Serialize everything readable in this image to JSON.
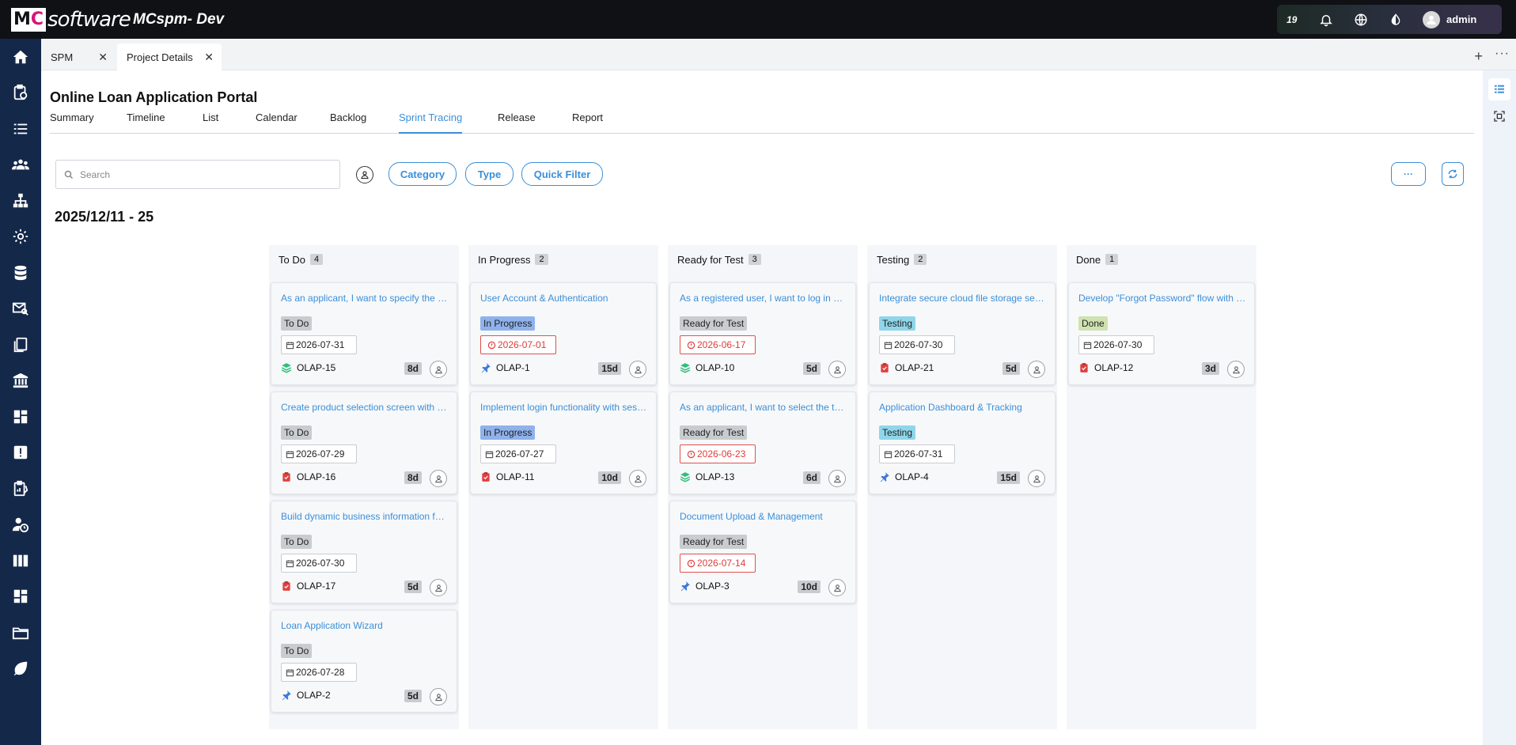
{
  "topbar": {
    "logo_mc": "MC",
    "logo_software": "software",
    "app_title": "MCspm- Dev",
    "notification_count": "19",
    "user_name": "admin"
  },
  "sidebar": {
    "items": [
      "home-icon",
      "clipboard-clock-icon",
      "list-icon",
      "team-icon",
      "hierarchy-icon",
      "gear-icon",
      "database-icon",
      "mail-search-icon",
      "documents-icon",
      "bank-icon",
      "dashboard-icon",
      "alert-icon",
      "clipboard-chart-icon",
      "user-clock-icon",
      "library-icon",
      "grid-icon",
      "folder-icon",
      "leaf-icon"
    ]
  },
  "window_tabs": [
    {
      "label": "SPM",
      "active": false
    },
    {
      "label": "Project Details",
      "active": true
    }
  ],
  "project": {
    "title": "Online Loan Application Portal",
    "nav_tabs": [
      "Summary",
      "Timeline",
      "List",
      "Calendar",
      "Backlog",
      "Sprint Tracing",
      "Release",
      "Report"
    ],
    "active_tab": "Sprint Tracing"
  },
  "toolbar": {
    "search_placeholder": "Search",
    "category": "Category",
    "type": "Type",
    "quick_filter": "Quick Filter",
    "more": "···"
  },
  "sprint": {
    "range": "2025/12/11 - 25"
  },
  "colors": {
    "accent": "#3b8fd8",
    "sidebar": "#14284a",
    "overdue": "#e03b3b"
  },
  "columns": [
    {
      "title": "To Do",
      "count": "4",
      "cards": [
        {
          "title": "As an applicant, I want to specify the loan amount and term",
          "status": "To Do",
          "date": "2026-07-31",
          "overdue": false,
          "type": "story",
          "key": "OLAP-15",
          "estimate": "8d"
        },
        {
          "title": "Create product selection screen with loan options",
          "status": "To Do",
          "date": "2026-07-29",
          "overdue": false,
          "type": "task",
          "key": "OLAP-16",
          "estimate": "8d"
        },
        {
          "title": "Build dynamic business information form",
          "status": "To Do",
          "date": "2026-07-30",
          "overdue": false,
          "type": "task",
          "key": "OLAP-17",
          "estimate": "5d"
        },
        {
          "title": "Loan Application Wizard",
          "status": "To Do",
          "date": "2026-07-28",
          "overdue": false,
          "type": "epic",
          "key": "OLAP-2",
          "estimate": "5d"
        }
      ]
    },
    {
      "title": "In Progress",
      "count": "2",
      "cards": [
        {
          "title": "User Account & Authentication",
          "status": "In Progress",
          "date": "2026-07-01",
          "overdue": true,
          "type": "epic",
          "key": "OLAP-1",
          "estimate": "15d"
        },
        {
          "title": "Implement login functionality with session management",
          "status": "In Progress",
          "date": "2026-07-27",
          "overdue": false,
          "type": "task",
          "key": "OLAP-11",
          "estimate": "10d"
        }
      ]
    },
    {
      "title": "Ready for Test",
      "count": "3",
      "cards": [
        {
          "title": "As a registered user, I want to log in securely",
          "status": "Ready for Test",
          "date": "2026-06-17",
          "overdue": true,
          "type": "story",
          "key": "OLAP-10",
          "estimate": "5d"
        },
        {
          "title": "As an applicant, I want to select the type of loan",
          "status": "Ready for Test",
          "date": "2026-06-23",
          "overdue": true,
          "type": "story",
          "key": "OLAP-13",
          "estimate": "6d"
        },
        {
          "title": "Document Upload & Management",
          "status": "Ready for Test",
          "date": "2026-07-14",
          "overdue": true,
          "type": "epic",
          "key": "OLAP-3",
          "estimate": "10d"
        }
      ]
    },
    {
      "title": "Testing",
      "count": "2",
      "cards": [
        {
          "title": "Integrate secure cloud file storage service",
          "status": "Testing",
          "date": "2026-07-30",
          "overdue": false,
          "type": "task",
          "key": "OLAP-21",
          "estimate": "5d"
        },
        {
          "title": "Application Dashboard & Tracking",
          "status": "Testing",
          "date": "2026-07-31",
          "overdue": false,
          "type": "epic",
          "key": "OLAP-4",
          "estimate": "15d"
        }
      ]
    },
    {
      "title": "Done",
      "count": "1",
      "cards": [
        {
          "title": "Develop \"Forgot Password\" flow with email reset",
          "status": "Done",
          "date": "2026-07-30",
          "overdue": false,
          "type": "task",
          "key": "OLAP-12",
          "estimate": "3d"
        }
      ]
    }
  ]
}
